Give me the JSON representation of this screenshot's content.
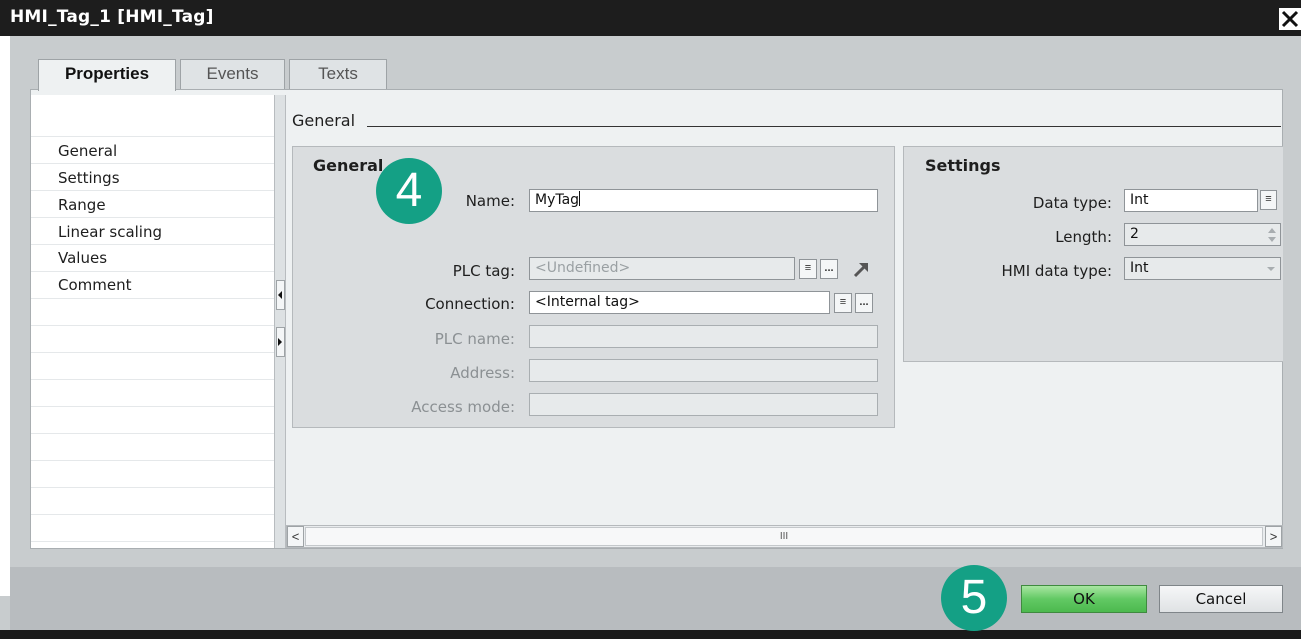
{
  "window": {
    "title": "HMI_Tag_1 [HMI_Tag]"
  },
  "tabs": [
    {
      "label": "Properties",
      "active": true
    },
    {
      "label": "Events",
      "active": false
    },
    {
      "label": "Texts",
      "active": false
    }
  ],
  "nav": {
    "items": [
      {
        "label": "General",
        "selected": true
      },
      {
        "label": "Settings"
      },
      {
        "label": "Range"
      },
      {
        "label": "Linear scaling"
      },
      {
        "label": "Values"
      },
      {
        "label": "Comment"
      }
    ]
  },
  "content": {
    "section_title": "General",
    "general": {
      "title": "General",
      "name_label": "Name:",
      "name_value": "MyTag",
      "plc_tag_label": "PLC tag:",
      "plc_tag_value": "<Undefined>",
      "connection_label": "Connection:",
      "connection_value": "<Internal tag>",
      "plc_name_label": "PLC name:",
      "address_label": "Address:",
      "access_mode_label": "Access mode:",
      "browse_glyph": "...",
      "list_glyph": "≡",
      "goto_icon": "arrow-up-right-icon"
    },
    "settings": {
      "title": "Settings",
      "data_type_label": "Data type:",
      "data_type_value": "Int",
      "length_label": "Length:",
      "length_value": "2",
      "hmi_data_type_label": "HMI data type:",
      "hmi_data_type_value": "Int"
    }
  },
  "scrollbar": {
    "left": "<",
    "right": ">",
    "grip": "III"
  },
  "footer": {
    "ok_label": "OK",
    "cancel_label": "Cancel"
  },
  "badges": {
    "step_name": "4",
    "step_ok": "5"
  },
  "colors": {
    "badge": "#14a085",
    "ok_button": "#62c964",
    "titlebar": "#1d1d1d"
  }
}
